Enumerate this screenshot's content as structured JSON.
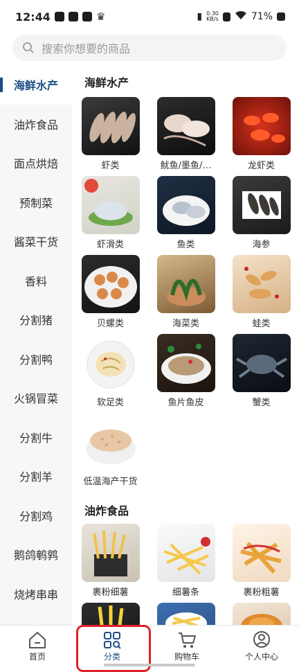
{
  "status_bar": {
    "time": "12:44",
    "speed_top": "0.30",
    "speed_bottom": "KB/s",
    "battery": "71%"
  },
  "search": {
    "placeholder": "搜索你想要的商品"
  },
  "sidebar": {
    "items": [
      {
        "label": "海鲜水产"
      },
      {
        "label": "油炸食品"
      },
      {
        "label": "面点烘焙"
      },
      {
        "label": "预制菜"
      },
      {
        "label": "酱菜干货"
      },
      {
        "label": "香料"
      },
      {
        "label": "分割猪"
      },
      {
        "label": "分割鸭"
      },
      {
        "label": "火锅冒菜"
      },
      {
        "label": "分割牛"
      },
      {
        "label": "分割羊"
      },
      {
        "label": "分割鸡"
      },
      {
        "label": "鹅鸽鹌鹑"
      },
      {
        "label": "烧烤串串"
      }
    ]
  },
  "sections": [
    {
      "title": "海鲜水产",
      "items": [
        {
          "label": "虾类"
        },
        {
          "label": "鱿鱼/墨鱼/…"
        },
        {
          "label": "龙虾类"
        },
        {
          "label": "虾滑类"
        },
        {
          "label": "鱼类"
        },
        {
          "label": "海参"
        },
        {
          "label": "贝螺类"
        },
        {
          "label": "海菜类"
        },
        {
          "label": "蛙类"
        },
        {
          "label": "软足类"
        },
        {
          "label": "鱼片鱼皮"
        },
        {
          "label": "蟹类"
        },
        {
          "label": "低温海产干货"
        }
      ]
    },
    {
      "title": "油炸食品",
      "items": [
        {
          "label": "裹粉细薯"
        },
        {
          "label": "细薯条"
        },
        {
          "label": "裹粉粗薯"
        }
      ]
    }
  ],
  "tabbar": {
    "tabs": [
      {
        "label": "首页"
      },
      {
        "label": "分类"
      },
      {
        "label": "购物车"
      },
      {
        "label": "个人中心"
      }
    ]
  },
  "colors": {
    "accent": "#1a4f86",
    "highlight_box": "#e0202a"
  }
}
